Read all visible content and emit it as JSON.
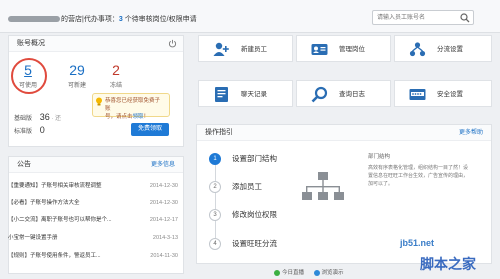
{
  "header": {
    "store_suffix": "的营店",
    "todo_prefix": "|代办事项：",
    "todo_count": "3",
    "todo_suffix": "个待审核岗位/权限申请",
    "search_placeholder": "请输入员工账号名"
  },
  "account": {
    "title": "账号概况",
    "stats": [
      {
        "value": "5",
        "label": "可使用",
        "color": "#1a6fc4"
      },
      {
        "value": "29",
        "label": "可新建",
        "color": "#1a6fc4"
      },
      {
        "value": "2",
        "label": "冻结",
        "color": "#c0392b"
      }
    ],
    "tip_text": "恭喜您已经获取免费子账号，请点击领取！",
    "tip_line1": "恭喜您已经获取免费子账",
    "tip_line2_prefix": "号，请点击",
    "tip_link": "领取",
    "tip_line2_suffix": "！",
    "base_label": "基础版",
    "base_value": "36",
    "base_extra": "· 还",
    "std_label": "标准版",
    "std_value": "0",
    "free_button": "免费领取"
  },
  "notice": {
    "title": "公告",
    "more": "更多信息",
    "items": [
      {
        "title": "【重要通知】子账号相关审核流程调整",
        "date": "2014-12-30"
      },
      {
        "title": "【必看】子账号操作方法大全",
        "date": "2014-12-30"
      },
      {
        "title": "【小二交流】离职子账号也可以帮你是个...",
        "date": "2014-12-17"
      },
      {
        "title": "小宝常一键设置手册",
        "date": "2014-3-13"
      },
      {
        "title": "【规则】子账号使用条件，警返员工...",
        "date": "2014-11-30"
      }
    ]
  },
  "tiles": [
    {
      "label": "新建员工",
      "icon": "add-user-icon"
    },
    {
      "label": "管理岗位",
      "icon": "id-card-icon"
    },
    {
      "label": "分流设置",
      "icon": "shunt-icon"
    },
    {
      "label": "聊天记录",
      "icon": "chat-record-icon"
    },
    {
      "label": "查询日志",
      "icon": "search-log-icon"
    },
    {
      "label": "安全设置",
      "icon": "security-icon"
    }
  ],
  "guide": {
    "title": "操作指引",
    "more": "更多帮助",
    "steps": [
      {
        "num": "1",
        "label": "设置部门结构"
      },
      {
        "num": "2",
        "label": "添加员工"
      },
      {
        "num": "3",
        "label": "修改岗位权限"
      },
      {
        "num": "4",
        "label": "设置旺旺分流"
      }
    ],
    "desc_title": "部门结构",
    "desc_text": "高效有序表格化管理，组织结构一目了然！设置信息在旺旺工作台生效，广告宣传的理由，加可以了。"
  },
  "footer": {
    "status1": "今日直播",
    "status2": "浏览演示"
  },
  "watermark": {
    "site": "jb51.net",
    "name": "脚本之家"
  },
  "colors": {
    "accent": "#1f7ad6",
    "highlight_circle": "#e04a3d",
    "icon_blue": "#2a6db3"
  }
}
